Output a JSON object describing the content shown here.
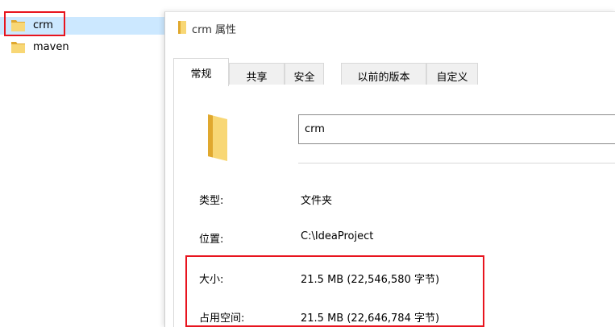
{
  "explorer": {
    "items": [
      {
        "name": "crm",
        "icon": "folder-icon",
        "selected": true
      },
      {
        "name": "maven",
        "icon": "folder-icon",
        "selected": false
      }
    ]
  },
  "dialog": {
    "title": "crm 属性",
    "tabs": [
      {
        "label": "常规",
        "active": true
      },
      {
        "label": "共享",
        "active": false
      },
      {
        "label": "安全",
        "active": false
      },
      {
        "label": "以前的版本",
        "active": false
      },
      {
        "label": "自定义",
        "active": false
      }
    ],
    "folder_name": "crm",
    "properties": [
      {
        "label": "类型:",
        "value": "文件夹"
      },
      {
        "label": "位置:",
        "value": "C:\\IdeaProject"
      },
      {
        "label": "大小:",
        "value": "21.5 MB (22,546,580 字节)"
      },
      {
        "label": "占用空间:",
        "value": "21.5 MB (22,646,784 字节)"
      }
    ]
  },
  "colors": {
    "highlight_box": "#e8141e",
    "selection": "#cce8ff",
    "folder": "#f8d775",
    "folder_dark": "#e0a82e"
  }
}
